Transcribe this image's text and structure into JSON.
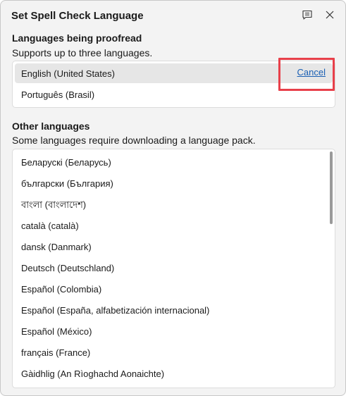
{
  "dialog": {
    "title": "Set Spell Check Language",
    "feedback_icon": "feedback-icon",
    "close_icon": "close-icon"
  },
  "proofread": {
    "heading": "Languages being proofread",
    "subtext": "Supports up to three languages.",
    "items": [
      {
        "label": "English (United States)",
        "selected": true
      },
      {
        "label": "Português (Brasil)",
        "selected": false
      }
    ],
    "cancel_label": "Cancel"
  },
  "other": {
    "heading": "Other languages",
    "subtext": "Some languages require downloading a language pack.",
    "items": [
      "Беларускі (Беларусь)",
      "български (България)",
      "বাংলা (বাংলাদেশ)",
      "català (català)",
      "dansk (Danmark)",
      "Deutsch (Deutschland)",
      "Español (Colombia)",
      "Español (España, alfabetización internacional)",
      "Español (México)",
      "français (France)",
      "Gàidhlig (An Rìoghachd Aonaichte)"
    ]
  },
  "colors": {
    "accent_link": "#1a5fb4",
    "highlight": "#e8404a",
    "selected_row": "#e6e6e6"
  }
}
